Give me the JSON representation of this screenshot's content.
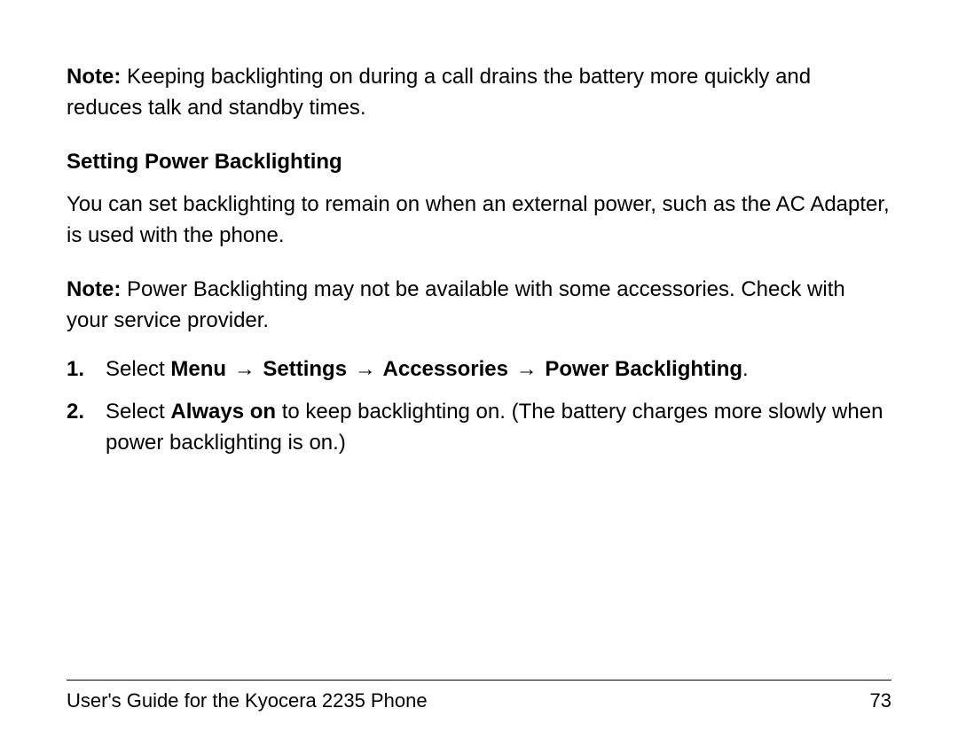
{
  "note1": {
    "label": "Note:",
    "text": " Keeping backlighting on during a call drains the battery more quickly and reduces talk and standby times."
  },
  "heading": "Setting Power Backlighting",
  "para1": "You can set backlighting to remain on when an external power, such as the AC Adapter, is used with the phone.",
  "note2": {
    "label": "Note:",
    "text": " Power Backlighting may not be available with some accessories. Check with your service provider."
  },
  "steps": [
    {
      "number": "1.",
      "prefix": "Select ",
      "path_parts": [
        "Menu",
        "Settings",
        "Accessories",
        "Power Backlighting"
      ],
      "suffix": "."
    },
    {
      "number": "2.",
      "prefix": "Select ",
      "bold_part": "Always on",
      "rest": " to keep backlighting on. (The battery charges more slowly when power backlighting is on.)"
    }
  ],
  "arrow_glyph": "→",
  "footer": {
    "title": "User's Guide for the Kyocera 2235 Phone",
    "page": "73"
  }
}
